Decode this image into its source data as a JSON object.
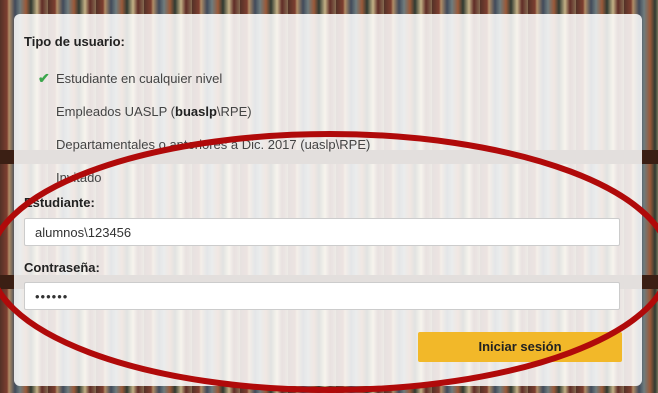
{
  "tipo_usuario": {
    "title": "Tipo de usuario:",
    "options": [
      {
        "pre": "Estudiante en cualquier nivel",
        "bold": "",
        "post": ""
      },
      {
        "pre": "Empleados UASLP (",
        "bold": "buaslp",
        "post": "\\RPE)"
      },
      {
        "pre": "Departamentales o anteriores a Dic. 2017 (uaslp\\RPE)",
        "bold": "",
        "post": ""
      },
      {
        "pre": "Invitado",
        "bold": "",
        "post": ""
      }
    ],
    "selected_index": 0
  },
  "form": {
    "user_label": "Estudiante:",
    "user_value": "alumnos\\123456",
    "password_label": "Contraseña:",
    "password_value": "••••••",
    "submit_label": "Iniciar sesión"
  },
  "colors": {
    "accent": "#f2b829",
    "check": "#3aa64b",
    "annotation": "#b00a0a"
  },
  "icons": {
    "selected": "check-icon"
  }
}
